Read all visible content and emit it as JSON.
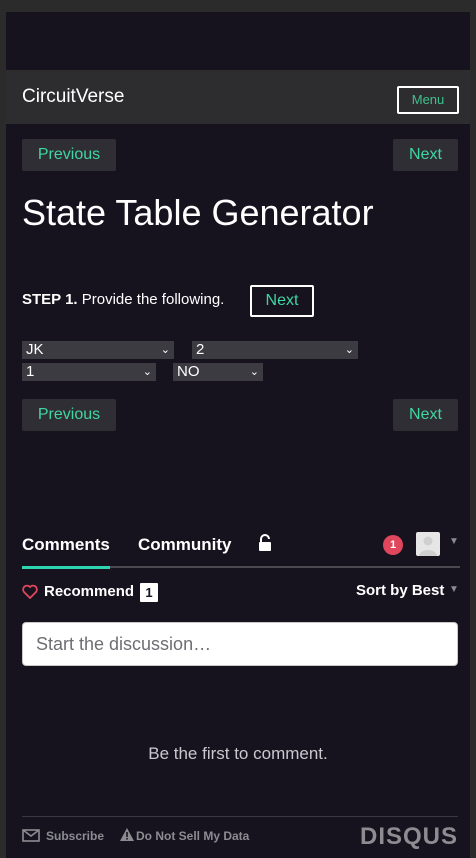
{
  "navbar": {
    "brand": "CircuitVerse",
    "menu_label": "Menu"
  },
  "pagination_top": {
    "previous": "Previous",
    "next": "Next"
  },
  "page": {
    "title": "State Table Generator",
    "step_label": "STEP 1.",
    "step_text": " Provide the following.",
    "step_next": "Next"
  },
  "selects": {
    "flipflop": "JK",
    "count": "2",
    "inputs": "1",
    "output": "NO"
  },
  "pagination_bottom": {
    "previous": "Previous",
    "next": "Next"
  },
  "comments": {
    "tab_comments": "Comments",
    "tab_community": "Community",
    "notification_count": "1",
    "recommend_label": "Recommend",
    "recommend_count": "1",
    "sort_label": "Sort by Best",
    "input_placeholder": "Start the discussion…",
    "empty_message": "Be the first to comment.",
    "footer_subscribe": "Subscribe",
    "footer_dnsmd": "Do Not Sell My Data",
    "footer_brand": "DISQUS"
  },
  "colors": {
    "accent": "#3fd6a0",
    "background": "#16131f",
    "navbar": "#2d2c2f",
    "notification": "#e0465c",
    "tab_active": "#2fd5b0"
  },
  "icons": {
    "lock": "lock-icon",
    "heart": "heart-icon",
    "mail": "mail-icon",
    "warning": "warning-icon"
  }
}
